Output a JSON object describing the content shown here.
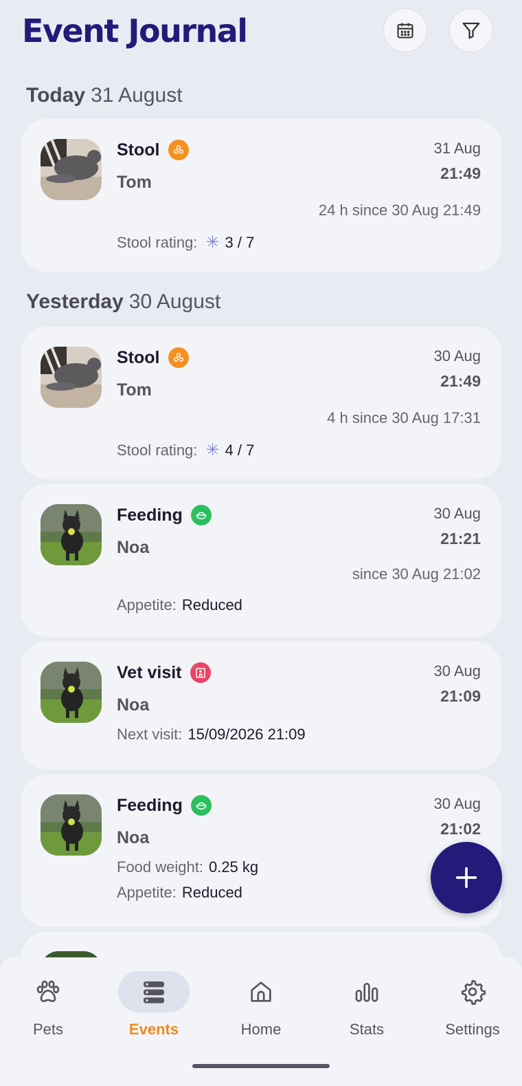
{
  "header": {
    "title": "Event Journal",
    "calendar_icon": "calendar-icon",
    "filter_icon": "filter-icon"
  },
  "sections": [
    {
      "label": "Today",
      "date": "31 August"
    },
    {
      "label": "Yesterday",
      "date": "30 August"
    }
  ],
  "events": [
    {
      "type": "Stool",
      "badge": "stool-icon",
      "badge_color": "#f5901e",
      "pet": "Tom",
      "date": "31 Aug",
      "time": "21:49",
      "since": "24 h since 30 Aug 21:49",
      "detail_label": "Stool rating:",
      "detail_value": "3 / 7"
    },
    {
      "type": "Stool",
      "badge": "stool-icon",
      "badge_color": "#f5901e",
      "pet": "Tom",
      "date": "30 Aug",
      "time": "21:49",
      "since": "4 h since 30 Aug 17:31",
      "detail_label": "Stool rating:",
      "detail_value": "4 / 7"
    },
    {
      "type": "Feeding",
      "badge": "bowl-icon",
      "badge_color": "#2bbf5e",
      "pet": "Noa",
      "date": "30 Aug",
      "time": "21:21",
      "since": "since 30 Aug 21:02",
      "detail_label": "Appetite:",
      "detail_value": "Reduced"
    },
    {
      "type": "Vet visit",
      "badge": "hospital-icon",
      "badge_color": "#ea4466",
      "pet": "Noa",
      "date": "30 Aug",
      "time": "21:09",
      "detail_label": "Next visit:",
      "detail_value": "15/09/2026 21:09"
    },
    {
      "type": "Feeding",
      "badge": "bowl-icon",
      "badge_color": "#2bbf5e",
      "pet": "Noa",
      "date": "30 Aug",
      "time": "21:02",
      "detail_label": "Food weight:",
      "detail_value": "0.25 kg",
      "detail2_label": "Appetite:",
      "detail2_value": "Reduced"
    }
  ],
  "fab": {
    "icon": "plus-icon"
  },
  "nav": [
    {
      "label": "Pets",
      "icon": "paw-icon"
    },
    {
      "label": "Events",
      "icon": "events-stack-icon",
      "active": true
    },
    {
      "label": "Home",
      "icon": "home-icon"
    },
    {
      "label": "Stats",
      "icon": "stats-icon"
    },
    {
      "label": "Settings",
      "icon": "gear-icon"
    }
  ],
  "colors": {
    "brand": "#241a7a",
    "active_nav": "#f0891a",
    "background": "#e9ebf3",
    "card": "#f3f4f8",
    "rating_star": "#8087d8"
  }
}
